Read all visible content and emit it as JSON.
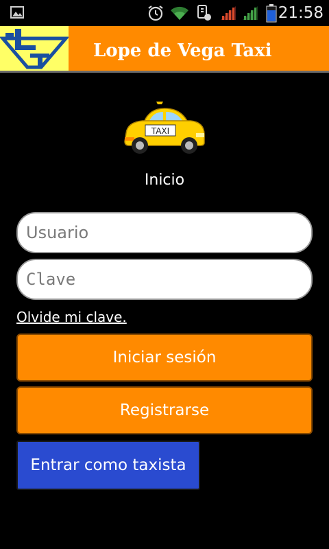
{
  "status_bar": {
    "time": "21:58",
    "icons": [
      "picture-notification-icon",
      "alarm-icon",
      "wifi-icon",
      "usb-debug-icon",
      "signal-icon-1",
      "signal-icon-2",
      "battery-icon"
    ]
  },
  "header": {
    "title": "Lope de Vega Taxi",
    "logo": "lope-de-vega-logo"
  },
  "main": {
    "taxi_sign": "TAXI",
    "heading": "Inicio",
    "username_placeholder": "Usuario",
    "password_placeholder": "Clave",
    "forgot_link": "Olvide mi clave.",
    "login_button": "Iniciar sesión",
    "register_button": "Registrarse",
    "driver_button": "Entrar como taxista"
  },
  "colors": {
    "accent_orange": "#ff8a00",
    "driver_blue": "#2a4bd0",
    "background": "#000000"
  }
}
